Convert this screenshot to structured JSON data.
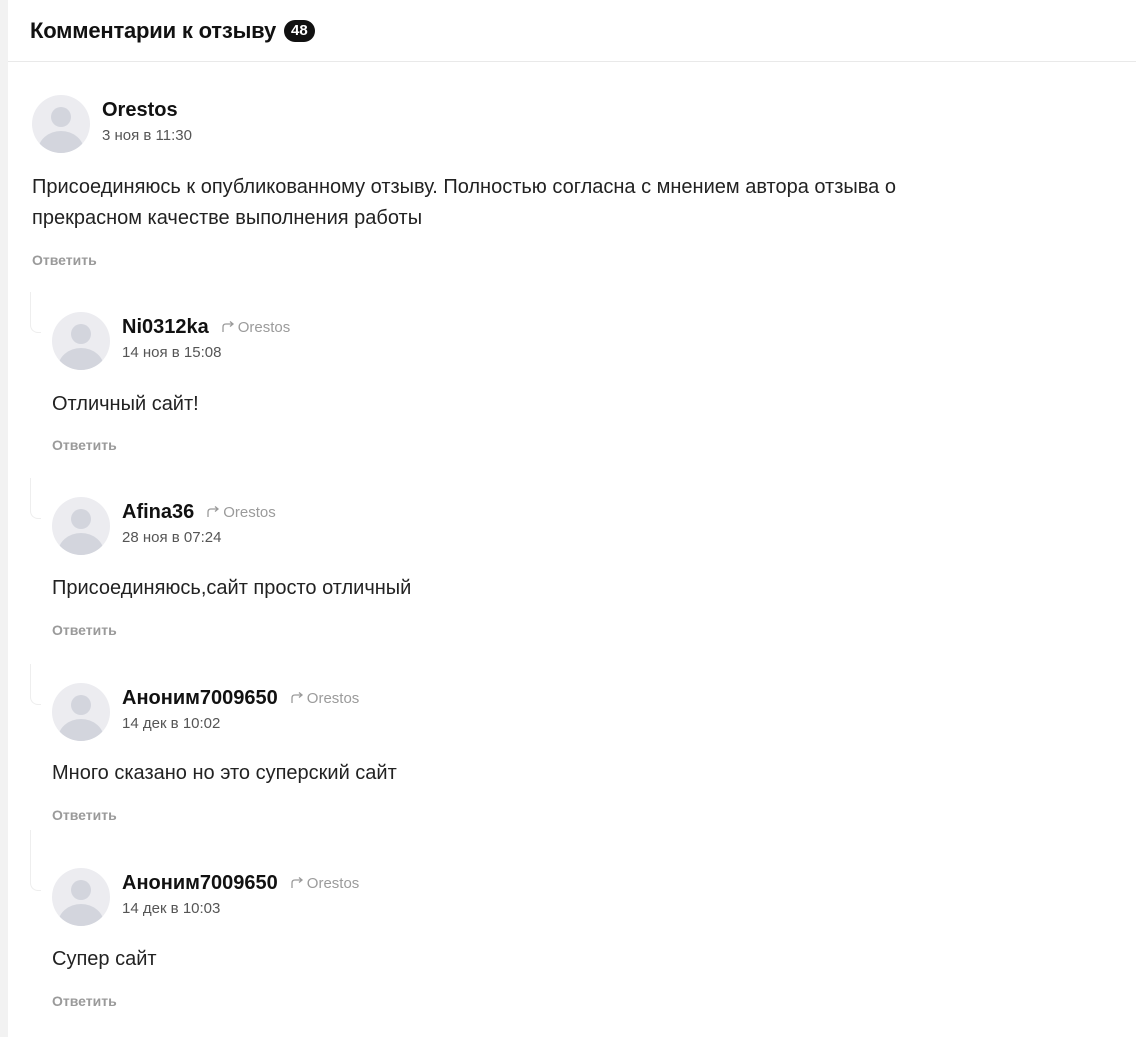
{
  "header": {
    "title": "Комментарии к отзыву",
    "count": "48"
  },
  "comments": [
    {
      "author": "Orestos",
      "date": "3 ноя в 11:30",
      "text_line1": "Присоединяюсь к опубликованному отзыву. Полностью согласна с мнением автора отзыва о",
      "text_line2": "прекрасном качестве выполнения работы",
      "reply_label": "Ответить"
    },
    {
      "author": "Ni0312ka",
      "reply_to": "Orestos",
      "date": "14 ноя в 15:08",
      "text": "Отличный сайт!",
      "reply_label": "Ответить"
    },
    {
      "author": "Afina36",
      "reply_to": "Orestos",
      "date": "28 ноя в 07:24",
      "text": "Присоединяюсь,сайт просто отличный",
      "reply_label": "Ответить"
    },
    {
      "author": "Аноним7009650",
      "reply_to": "Orestos",
      "date": "14 дек в 10:02",
      "text": "Много сказано но это суперский сайт",
      "reply_label": "Ответить"
    },
    {
      "author": "Аноним7009650",
      "reply_to": "Orestos",
      "date": "14 дек в 10:03",
      "text": "Супер сайт",
      "reply_label": "Ответить"
    }
  ],
  "icons": {
    "avatar": "default-avatar-icon",
    "reply_arrow": "reply-arrow-icon"
  }
}
